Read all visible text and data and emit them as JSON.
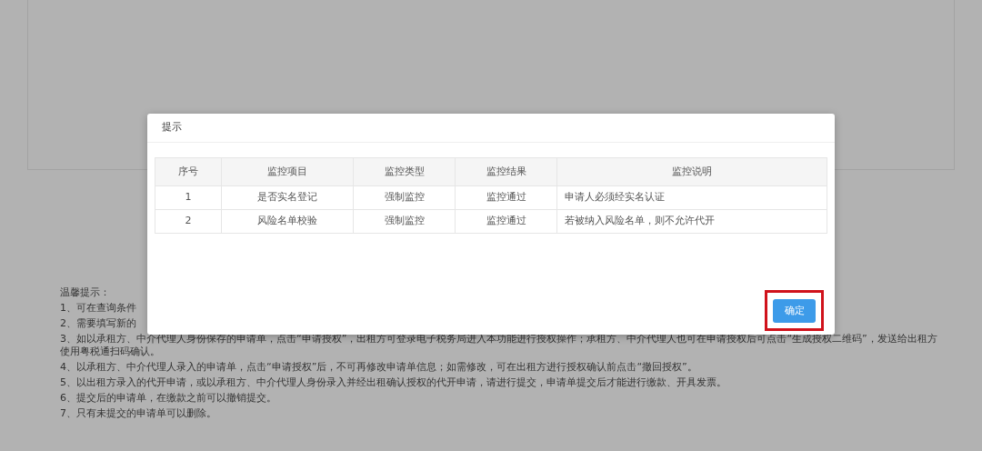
{
  "notes": {
    "title": "温馨提示：",
    "items": [
      "1、可在查询条件",
      "2、需要填写新的",
      "3、如以承租方、中介代理人身份保存的申请单，点击“申请授权”，出租方可登录电子税务局进入本功能进行授权操作；承租方、中介代理人也可在申请授权后可点击“生成授权二维码”，发送给出租方使用粤税通扫码确认。",
      "4、以承租方、中介代理人录入的申请单，点击“申请授权”后，不可再修改申请单信息；如需修改，可在出租方进行授权确认前点击“撤回授权”。",
      "5、以出租方录入的代开申请，或以承租方、中介代理人身份录入并经出租确认授权的代开申请，请进行提交，申请单提交后才能进行缴款、开具发票。",
      "6、提交后的申请单，在缴款之前可以撤销提交。",
      "7、只有未提交的申请单可以删除。"
    ]
  },
  "dialog": {
    "title": "提示",
    "table": {
      "columns": [
        "序号",
        "监控项目",
        "监控类型",
        "监控结果",
        "监控说明"
      ],
      "rows": [
        [
          "1",
          "是否实名登记",
          "强制监控",
          "监控通过",
          "申请人必须经实名认证"
        ],
        [
          "2",
          "风险名单校验",
          "强制监控",
          "监控通过",
          "若被纳入风险名单，则不允许代开"
        ]
      ]
    },
    "confirm_button": {
      "label": "确定",
      "highlighted": true
    }
  }
}
